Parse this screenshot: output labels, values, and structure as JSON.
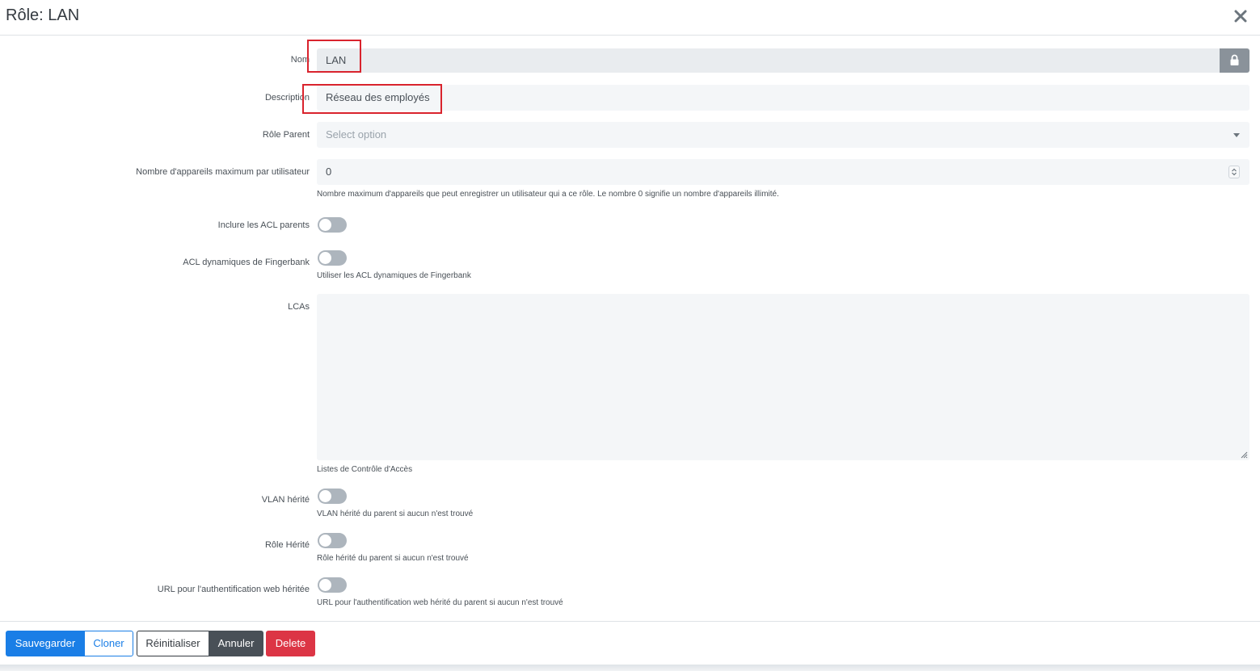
{
  "header": {
    "title": "Rôle: LAN"
  },
  "form": {
    "nom": {
      "label": "Nom",
      "value": "LAN"
    },
    "description": {
      "label": "Description",
      "value": "Réseau des employés"
    },
    "parent": {
      "label": "Rôle Parent",
      "placeholder": "Select option"
    },
    "max_devices": {
      "label": "Nombre d'appareils maximum par utilisateur",
      "value": "0",
      "help": "Nombre maximum d'appareils que peut enregistrer un utilisateur qui a ce rôle. Le nombre 0 signifie un nombre d'appareils illimité."
    },
    "include_parent_acls": {
      "label": "Inclure les ACL parents",
      "checked": false
    },
    "fingerbank_acls": {
      "label": "ACL dynamiques de Fingerbank",
      "help": "Utiliser les ACL dynamiques de Fingerbank",
      "checked": false
    },
    "lcas": {
      "label": "LCAs",
      "value": "",
      "help": "Listes de Contrôle d'Accès"
    },
    "inherit_vlan": {
      "label": "VLAN hérité",
      "help": "VLAN hérité du parent si aucun n'est trouvé",
      "checked": false
    },
    "inherit_role": {
      "label": "Rôle Hérité",
      "help": "Rôle hérité du parent si aucun n'est trouvé",
      "checked": false
    },
    "inherit_web_auth_url": {
      "label": "URL pour l'authentification web héritée",
      "help": "URL pour l'authentification web hérité du parent si aucun n'est trouvé",
      "checked": false
    }
  },
  "footer": {
    "save": "Sauvegarder",
    "clone": "Cloner",
    "reset": "Réinitialiser",
    "cancel": "Annuler",
    "delete": "Delete"
  },
  "colors": {
    "primary": "#1a7ee6",
    "danger": "#dc3545",
    "secondary": "#495057",
    "highlight": "#d9232d"
  },
  "icons": [
    "close-icon",
    "lock-icon",
    "chevron-down-icon",
    "spinner-arrows-icon",
    "resize-grip-icon"
  ]
}
